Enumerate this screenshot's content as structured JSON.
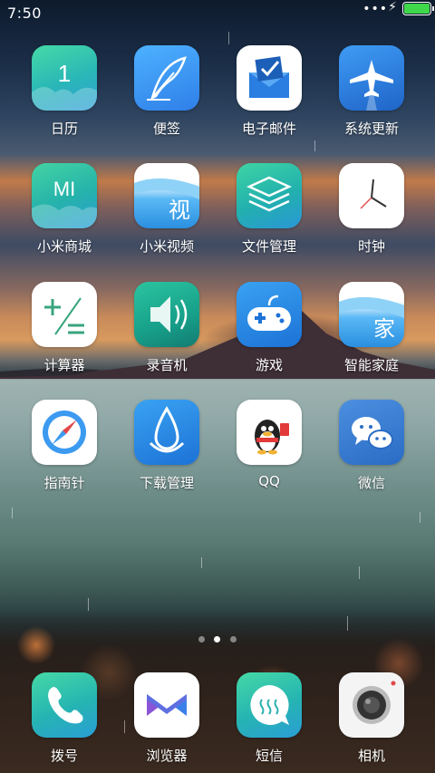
{
  "status": {
    "time": "7:50",
    "battery_level": 1.0
  },
  "apps": [
    {
      "label": "日历",
      "icon": "calendar-icon",
      "glyph": "1"
    },
    {
      "label": "便签",
      "icon": "notes-feather-icon"
    },
    {
      "label": "电子邮件",
      "icon": "email-icon"
    },
    {
      "label": "系统更新",
      "icon": "system-update-plane-icon"
    },
    {
      "label": "小米商城",
      "icon": "mi-store-icon",
      "glyph": "MI"
    },
    {
      "label": "小米视频",
      "icon": "mi-video-icon",
      "glyph": "视"
    },
    {
      "label": "文件管理",
      "icon": "file-manager-layers-icon"
    },
    {
      "label": "时钟",
      "icon": "clock-icon"
    },
    {
      "label": "计算器",
      "icon": "calculator-icon"
    },
    {
      "label": "录音机",
      "icon": "recorder-speaker-icon"
    },
    {
      "label": "游戏",
      "icon": "game-controller-icon"
    },
    {
      "label": "智能家庭",
      "icon": "smart-home-icon",
      "glyph": "家"
    },
    {
      "label": "指南针",
      "icon": "compass-icon"
    },
    {
      "label": "下载管理",
      "icon": "download-drop-icon"
    },
    {
      "label": "QQ",
      "icon": "qq-penguin-icon"
    },
    {
      "label": "微信",
      "icon": "wechat-icon"
    }
  ],
  "dock": [
    {
      "label": "拨号",
      "icon": "phone-icon"
    },
    {
      "label": "浏览器",
      "icon": "browser-icon"
    },
    {
      "label": "短信",
      "icon": "messages-icon"
    },
    {
      "label": "相机",
      "icon": "camera-icon"
    }
  ],
  "pager": {
    "pages": 3,
    "active": 1
  }
}
